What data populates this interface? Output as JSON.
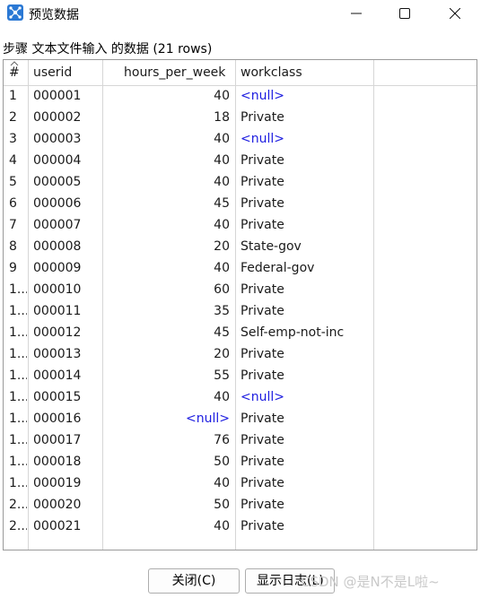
{
  "window": {
    "title": "预览数据",
    "icon": "kettle-spoon-icon"
  },
  "step_label": "步骤 文本文件输入 的数据  (21 rows)",
  "table": {
    "columns": [
      "#",
      "userid",
      "hours_per_week",
      "workclass"
    ],
    "rows": [
      [
        "1",
        "000001",
        "40",
        "<null>"
      ],
      [
        "2",
        "000002",
        "18",
        "Private"
      ],
      [
        "3",
        "000003",
        "40",
        "<null>"
      ],
      [
        "4",
        "000004",
        "40",
        "Private"
      ],
      [
        "5",
        "000005",
        "40",
        "Private"
      ],
      [
        "6",
        "000006",
        "45",
        "Private"
      ],
      [
        "7",
        "000007",
        "40",
        "Private"
      ],
      [
        "8",
        "000008",
        "20",
        "State-gov"
      ],
      [
        "9",
        "000009",
        "40",
        "Federal-gov"
      ],
      [
        "1...",
        "000010",
        "60",
        "Private"
      ],
      [
        "1...",
        "000011",
        "35",
        "Private"
      ],
      [
        "1...",
        "000012",
        "45",
        "Self-emp-not-inc"
      ],
      [
        "1...",
        "000013",
        "20",
        "Private"
      ],
      [
        "1...",
        "000014",
        "55",
        "Private"
      ],
      [
        "1...",
        "000015",
        "40",
        "<null>"
      ],
      [
        "1...",
        "000016",
        "<null>",
        "Private"
      ],
      [
        "1...",
        "000017",
        "76",
        "Private"
      ],
      [
        "1...",
        "000018",
        "50",
        "Private"
      ],
      [
        "1...",
        "000019",
        "40",
        "Private"
      ],
      [
        "2...",
        "000020",
        "50",
        "Private"
      ],
      [
        "2...",
        "000021",
        "40",
        "Private"
      ]
    ]
  },
  "buttons": {
    "close": "关闭(C)",
    "show_log": "显示日志(L)"
  },
  "watermark": "CSDN @是N不是L啦~",
  "colors": {
    "null_value": "#1c1ce0",
    "grid_border": "#9a9a9a",
    "icon_blue": "#2a78d4"
  }
}
